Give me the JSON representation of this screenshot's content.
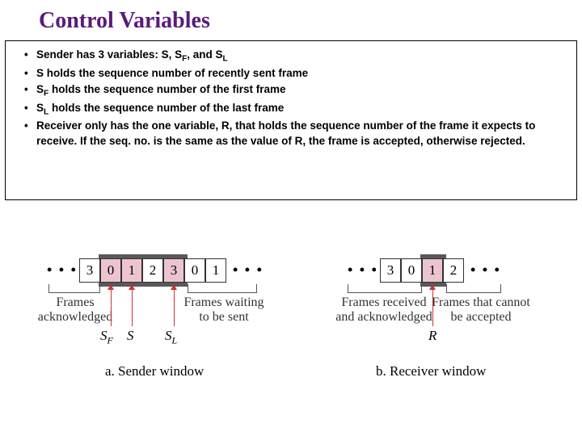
{
  "title": "Control Variables",
  "bullets": [
    {
      "pre": "Sender has 3 variables: S, S",
      "sub": "F",
      "post": ", and S",
      "sub2": "L",
      "tail": ""
    },
    {
      "text": "S holds the sequence number of recently sent frame"
    },
    {
      "pre": "S",
      "sub": "F",
      "post": " holds the sequence number of the first frame"
    },
    {
      "pre": "S",
      "sub": "L",
      "post": " holds the sequence number of the last frame"
    },
    {
      "text": "Receiver only has the one variable, R, that holds the sequence number of the frame it expects to receive. If the seq. no. is the same as the value of R, the frame is accepted, otherwise rejected."
    }
  ],
  "sender": {
    "cells": [
      "3",
      "0",
      "1",
      "2",
      "3",
      "0",
      "1"
    ],
    "window_start_index": 1,
    "window_end_index": 4,
    "ack_label_1": "Frames",
    "ack_label_2": "acknowledged",
    "wait_label_1": "Frames waiting",
    "wait_label_2": "to be sent",
    "vars": {
      "sf": "S",
      "sf_sub": "F",
      "s": "S",
      "sl": "S",
      "sl_sub": "L"
    },
    "caption": "a. Sender window"
  },
  "receiver": {
    "cells": [
      "3",
      "0",
      "1",
      "2"
    ],
    "window_start_index": 2,
    "window_end_index": 2,
    "recv_label_1": "Frames received",
    "recv_label_2": "and acknowledged",
    "cannot_label_1": "Frames that cannot",
    "cannot_label_2": "be accepted",
    "var": "R",
    "caption": "b. Receiver window"
  },
  "dots": "• • •"
}
